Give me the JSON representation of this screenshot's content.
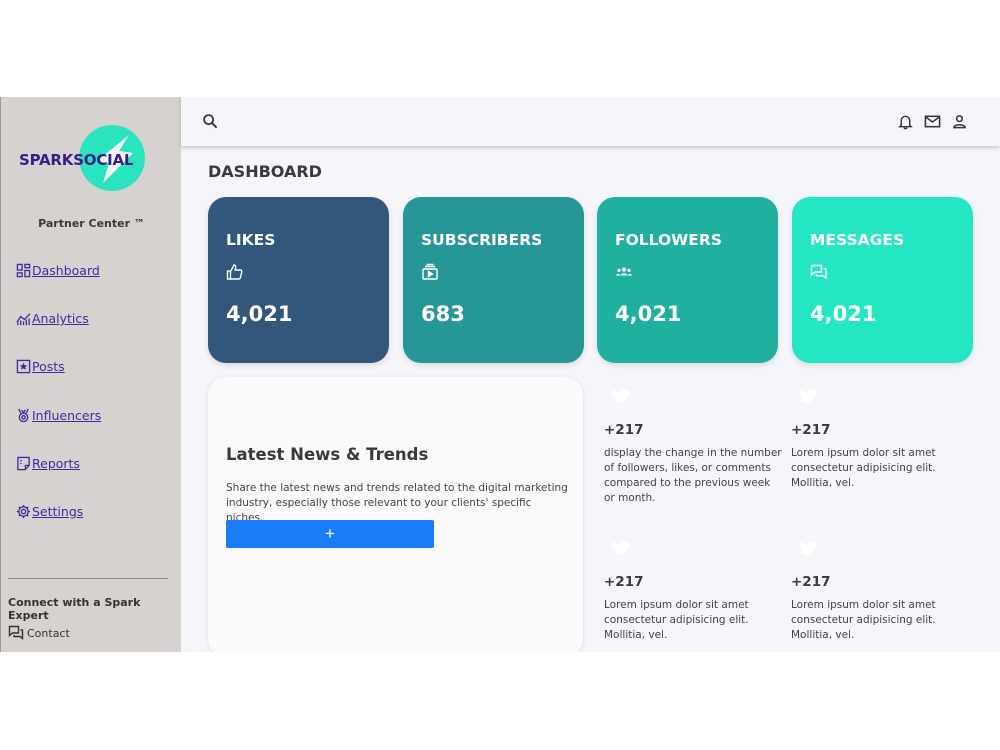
{
  "brand": {
    "logo_text": "SPARKSOCIAL",
    "subtitle": "Partner Center ™"
  },
  "sidebar": {
    "items": [
      {
        "label": " Dashboard",
        "icon": "dashboard-icon"
      },
      {
        "label": "Analytics",
        "icon": "analytics-icon"
      },
      {
        "label": "Posts",
        "icon": "posts-icon"
      },
      {
        "label": " Influencers",
        "icon": "influencers-icon"
      },
      {
        "label": "Reports",
        "icon": "reports-icon"
      },
      {
        "label": " Settings",
        "icon": "settings-icon"
      }
    ],
    "expert_heading": "Connect with a Spark Expert",
    "contact_label": "Contact"
  },
  "topbar": {
    "icons": [
      "search-icon",
      "bell-icon",
      "mail-icon",
      "user-icon"
    ]
  },
  "page_title": "DASHBOARD",
  "stats": [
    {
      "label": "LIKES",
      "value": "4,021",
      "icon": "thumbs-up-icon",
      "color": "#33577a"
    },
    {
      "label": "SUBSCRIBERS",
      "value": "683",
      "icon": "subscriptions-icon",
      "color": "#269696"
    },
    {
      "label": "FOLLOWERS",
      "value": "4,021",
      "icon": "group-icon",
      "color": "#20b0a0"
    },
    {
      "label": "MESSAGES",
      "value": "4,021",
      "icon": "chat-icon",
      "color": "#25e6c2"
    }
  ],
  "news": {
    "title": "Latest News & Trends",
    "description": "Share the latest news and trends related to the digital marketing industry, especially those relevant to your clients' specific niches.",
    "button_label": "+"
  },
  "trends": [
    {
      "delta": "+217",
      "text": "display the change in the number of followers, likes, or comments compared to the previous week or month."
    },
    {
      "delta": "+217",
      "text": "Lorem ipsum dolor sit amet consectetur adipisicing elit. Mollitia, vel."
    },
    {
      "delta": "+217",
      "text": "Lorem ipsum dolor sit amet consectetur adipisicing elit. Mollitia, vel."
    },
    {
      "delta": "+217",
      "text": "Lorem ipsum dolor sit amet consectetur adipisicing elit. Mollitia, vel."
    }
  ],
  "colors": {
    "accent": "#1a7cf8",
    "brand_purple": "#3a1d88",
    "brand_teal": "#2ae4c0",
    "sidebar_bg": "#d6d2d0"
  }
}
